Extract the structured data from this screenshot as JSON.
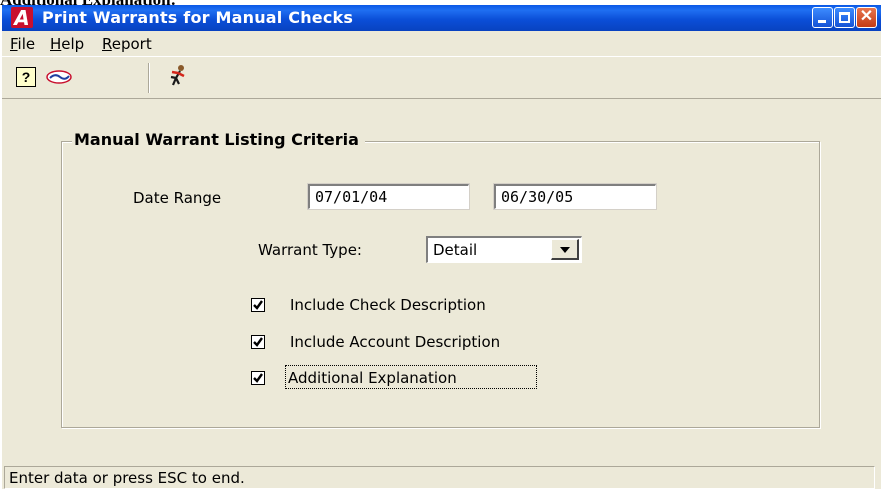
{
  "page_caption": "Additional Explanation:",
  "window": {
    "title": "Print Warrants for Manual Checks",
    "app_icon_letter": "A",
    "close_glyph": "✕"
  },
  "menu": {
    "file": "File",
    "help": "Help",
    "report": "Report"
  },
  "toolbar": {
    "help_glyph": "?",
    "logo_icon": "colored-logo-icon",
    "exit_icon": "running-man-exit-icon"
  },
  "criteria": {
    "group_title": "Manual Warrant Listing Criteria",
    "date_range_label": "Date Range",
    "date_from": "07/01/04",
    "date_to": "06/30/05",
    "warrant_type_label": "Warrant Type:",
    "warrant_type_value": "Detail",
    "options": [
      {
        "label": "Include Check Description",
        "checked": true
      },
      {
        "label": "Include Account Description",
        "checked": true
      },
      {
        "label": "Additional Explanation",
        "checked": true
      }
    ]
  },
  "status": {
    "text": "Enter data or press ESC to end."
  },
  "colors": {
    "titlebar": "#0b4fd8",
    "face": "#ece9d8",
    "app_icon": "#c8102e"
  }
}
